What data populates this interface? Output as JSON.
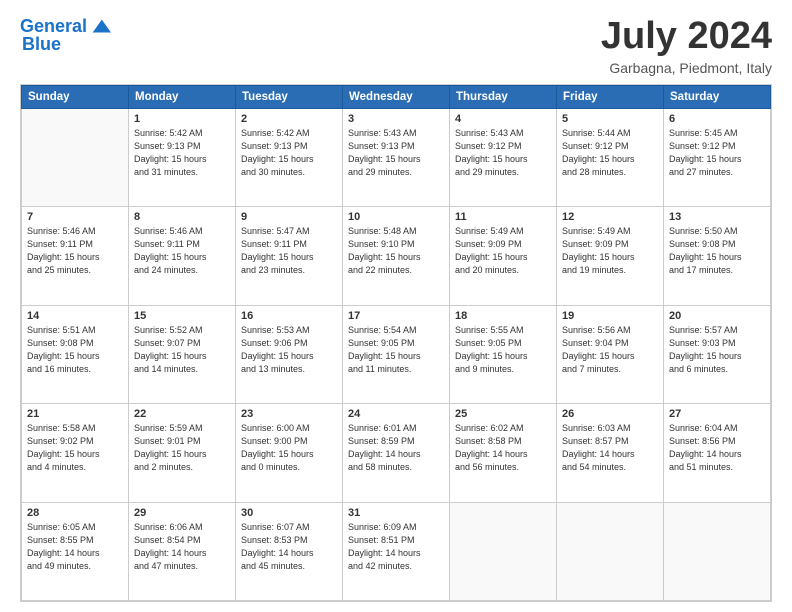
{
  "header": {
    "logo_line1": "General",
    "logo_line2": "Blue",
    "month": "July 2024",
    "location": "Garbagna, Piedmont, Italy"
  },
  "weekdays": [
    "Sunday",
    "Monday",
    "Tuesday",
    "Wednesday",
    "Thursday",
    "Friday",
    "Saturday"
  ],
  "weeks": [
    [
      {
        "day": "",
        "info": ""
      },
      {
        "day": "1",
        "info": "Sunrise: 5:42 AM\nSunset: 9:13 PM\nDaylight: 15 hours\nand 31 minutes."
      },
      {
        "day": "2",
        "info": "Sunrise: 5:42 AM\nSunset: 9:13 PM\nDaylight: 15 hours\nand 30 minutes."
      },
      {
        "day": "3",
        "info": "Sunrise: 5:43 AM\nSunset: 9:13 PM\nDaylight: 15 hours\nand 29 minutes."
      },
      {
        "day": "4",
        "info": "Sunrise: 5:43 AM\nSunset: 9:12 PM\nDaylight: 15 hours\nand 29 minutes."
      },
      {
        "day": "5",
        "info": "Sunrise: 5:44 AM\nSunset: 9:12 PM\nDaylight: 15 hours\nand 28 minutes."
      },
      {
        "day": "6",
        "info": "Sunrise: 5:45 AM\nSunset: 9:12 PM\nDaylight: 15 hours\nand 27 minutes."
      }
    ],
    [
      {
        "day": "7",
        "info": "Sunrise: 5:46 AM\nSunset: 9:11 PM\nDaylight: 15 hours\nand 25 minutes."
      },
      {
        "day": "8",
        "info": "Sunrise: 5:46 AM\nSunset: 9:11 PM\nDaylight: 15 hours\nand 24 minutes."
      },
      {
        "day": "9",
        "info": "Sunrise: 5:47 AM\nSunset: 9:11 PM\nDaylight: 15 hours\nand 23 minutes."
      },
      {
        "day": "10",
        "info": "Sunrise: 5:48 AM\nSunset: 9:10 PM\nDaylight: 15 hours\nand 22 minutes."
      },
      {
        "day": "11",
        "info": "Sunrise: 5:49 AM\nSunset: 9:09 PM\nDaylight: 15 hours\nand 20 minutes."
      },
      {
        "day": "12",
        "info": "Sunrise: 5:49 AM\nSunset: 9:09 PM\nDaylight: 15 hours\nand 19 minutes."
      },
      {
        "day": "13",
        "info": "Sunrise: 5:50 AM\nSunset: 9:08 PM\nDaylight: 15 hours\nand 17 minutes."
      }
    ],
    [
      {
        "day": "14",
        "info": "Sunrise: 5:51 AM\nSunset: 9:08 PM\nDaylight: 15 hours\nand 16 minutes."
      },
      {
        "day": "15",
        "info": "Sunrise: 5:52 AM\nSunset: 9:07 PM\nDaylight: 15 hours\nand 14 minutes."
      },
      {
        "day": "16",
        "info": "Sunrise: 5:53 AM\nSunset: 9:06 PM\nDaylight: 15 hours\nand 13 minutes."
      },
      {
        "day": "17",
        "info": "Sunrise: 5:54 AM\nSunset: 9:05 PM\nDaylight: 15 hours\nand 11 minutes."
      },
      {
        "day": "18",
        "info": "Sunrise: 5:55 AM\nSunset: 9:05 PM\nDaylight: 15 hours\nand 9 minutes."
      },
      {
        "day": "19",
        "info": "Sunrise: 5:56 AM\nSunset: 9:04 PM\nDaylight: 15 hours\nand 7 minutes."
      },
      {
        "day": "20",
        "info": "Sunrise: 5:57 AM\nSunset: 9:03 PM\nDaylight: 15 hours\nand 6 minutes."
      }
    ],
    [
      {
        "day": "21",
        "info": "Sunrise: 5:58 AM\nSunset: 9:02 PM\nDaylight: 15 hours\nand 4 minutes."
      },
      {
        "day": "22",
        "info": "Sunrise: 5:59 AM\nSunset: 9:01 PM\nDaylight: 15 hours\nand 2 minutes."
      },
      {
        "day": "23",
        "info": "Sunrise: 6:00 AM\nSunset: 9:00 PM\nDaylight: 15 hours\nand 0 minutes."
      },
      {
        "day": "24",
        "info": "Sunrise: 6:01 AM\nSunset: 8:59 PM\nDaylight: 14 hours\nand 58 minutes."
      },
      {
        "day": "25",
        "info": "Sunrise: 6:02 AM\nSunset: 8:58 PM\nDaylight: 14 hours\nand 56 minutes."
      },
      {
        "day": "26",
        "info": "Sunrise: 6:03 AM\nSunset: 8:57 PM\nDaylight: 14 hours\nand 54 minutes."
      },
      {
        "day": "27",
        "info": "Sunrise: 6:04 AM\nSunset: 8:56 PM\nDaylight: 14 hours\nand 51 minutes."
      }
    ],
    [
      {
        "day": "28",
        "info": "Sunrise: 6:05 AM\nSunset: 8:55 PM\nDaylight: 14 hours\nand 49 minutes."
      },
      {
        "day": "29",
        "info": "Sunrise: 6:06 AM\nSunset: 8:54 PM\nDaylight: 14 hours\nand 47 minutes."
      },
      {
        "day": "30",
        "info": "Sunrise: 6:07 AM\nSunset: 8:53 PM\nDaylight: 14 hours\nand 45 minutes."
      },
      {
        "day": "31",
        "info": "Sunrise: 6:09 AM\nSunset: 8:51 PM\nDaylight: 14 hours\nand 42 minutes."
      },
      {
        "day": "",
        "info": ""
      },
      {
        "day": "",
        "info": ""
      },
      {
        "day": "",
        "info": ""
      }
    ]
  ]
}
